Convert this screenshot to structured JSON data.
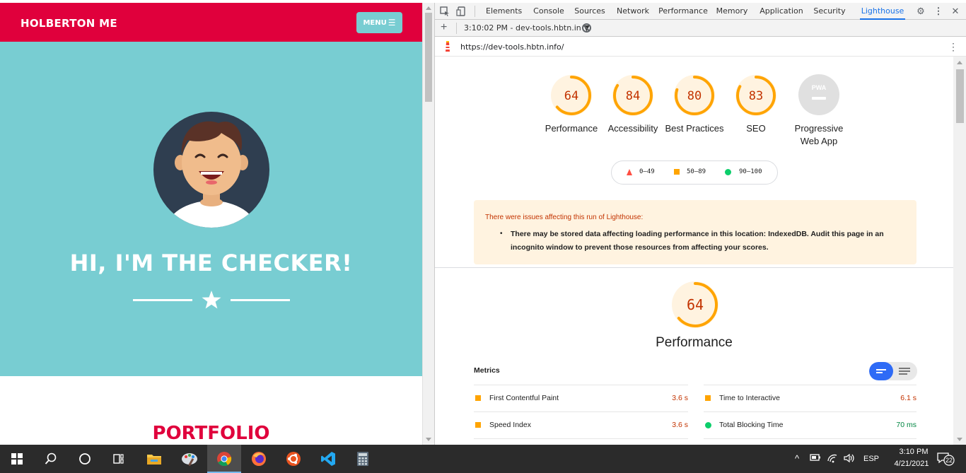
{
  "site": {
    "brand": "HOLBERTON ME",
    "menu_label": "MENU",
    "menu_icon": "hamburger-icon",
    "hero_title": "HI, I'M THE CHECKER!",
    "divider_icon": "star-icon",
    "section_title": "PORTFOLIO",
    "colors": {
      "primary": "#e0003c",
      "hero_bg": "#78cdd2"
    }
  },
  "devtools": {
    "tabs": [
      "Elements",
      "Console",
      "Sources",
      "Network",
      "Performance",
      "Memory",
      "Application",
      "Security",
      "Lighthouse"
    ],
    "active_tab": "Lighthouse",
    "report_selector": "3:10:02 PM - dev-tools.hbtn.in",
    "url": "https://dev-tools.hbtn.info/",
    "gauges": [
      {
        "score": "64",
        "label": "Performance",
        "value": 0.64
      },
      {
        "score": "84",
        "label": "Accessibility",
        "value": 0.84
      },
      {
        "score": "80",
        "label": "Best Practices",
        "value": 0.8
      },
      {
        "score": "83",
        "label": "SEO",
        "value": 0.83
      }
    ],
    "pwa": {
      "badge": "PWA",
      "label": "Progressive Web App"
    },
    "legend": [
      {
        "range": "0–49",
        "shape": "triangle",
        "color": "#ff4e42"
      },
      {
        "range": "50–89",
        "shape": "square",
        "color": "#ffa400"
      },
      {
        "range": "90–100",
        "shape": "circle",
        "color": "#0cce6b"
      }
    ],
    "warning": {
      "heading": "There were issues affecting this run of Lighthouse:",
      "message": "There may be stored data affecting loading performance in this location: IndexedDB. Audit this page in an incognito window to prevent those resources from affecting your scores."
    },
    "performance": {
      "score": "64",
      "value": 0.64,
      "title": "Performance"
    },
    "metrics_title": "Metrics",
    "metrics": [
      {
        "name": "First Contentful Paint",
        "value": "3.6 s",
        "status": "average"
      },
      {
        "name": "Time to Interactive",
        "value": "6.1 s",
        "status": "average"
      },
      {
        "name": "Speed Index",
        "value": "3.6 s",
        "status": "average"
      },
      {
        "name": "Total Blocking Time",
        "value": "70 ms",
        "status": "pass"
      }
    ],
    "colors": {
      "average": "#ffa400",
      "pass": "#0cce6b",
      "fail": "#ff4e42",
      "accent": "#1a73e8"
    }
  },
  "taskbar": {
    "apps": [
      "windows-start-icon",
      "search-icon",
      "cortana-icon",
      "task-view-icon",
      "file-explorer-icon",
      "paint-icon",
      "chrome-icon",
      "firefox-icon",
      "ubuntu-icon",
      "vscode-icon",
      "calculator-icon"
    ],
    "active_app": "chrome-icon",
    "language": "ESP",
    "time": "3:10 PM",
    "date": "4/21/2021",
    "notifications": "22"
  }
}
